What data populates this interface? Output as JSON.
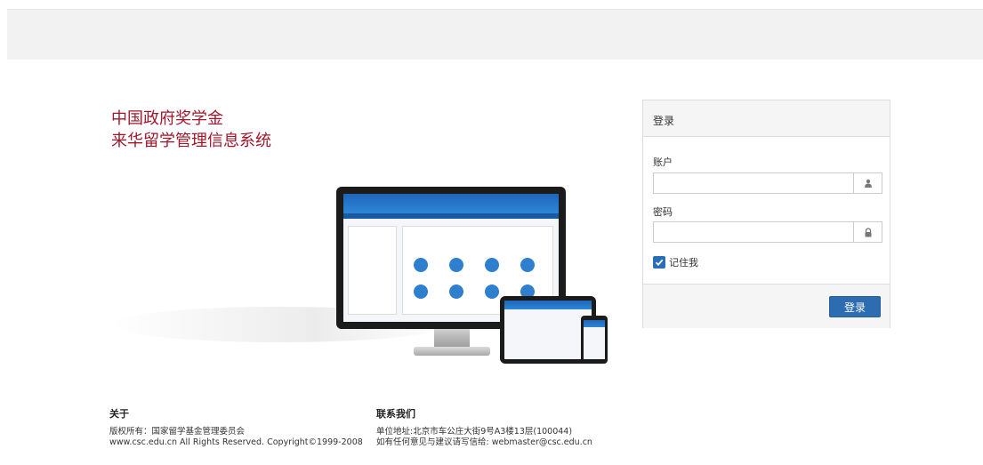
{
  "brand": {
    "line1": "中国政府奖学金",
    "line2": "来华留学管理信息系统",
    "color": "#a0172b"
  },
  "login": {
    "panel_title": "登录",
    "account_label": "账户",
    "account_value": "",
    "account_icon": "user-icon",
    "password_label": "密码",
    "password_value": "",
    "password_icon": "lock-icon",
    "remember_label": "记住我",
    "remember_checked": true,
    "submit_label": "登录",
    "button_color": "#2d6cb0"
  },
  "footer": {
    "about": {
      "title": "关于",
      "line1": "版权所有：国家留学基金管理委员会",
      "line2": "www.csc.edu.cn All Rights Reserved. Copyright©1999-2008"
    },
    "contact": {
      "title": "联系我们",
      "line1": "单位地址:北京市车公庄大街9号A3楼13层(100044)",
      "line2": "如有任何意见与建议请写信给: webmaster@csc.edu.cn"
    }
  }
}
